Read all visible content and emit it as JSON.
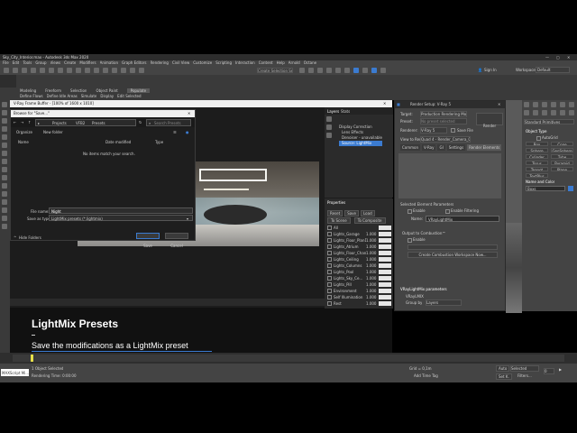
{
  "window": {
    "title": "Sky_City_Interior.max - Autodesk 3ds Max 2020"
  },
  "menu": [
    "File",
    "Edit",
    "Tools",
    "Group",
    "Views",
    "Create",
    "Modifiers",
    "Animation",
    "Graph Editors",
    "Rendering",
    "Civil View",
    "Customize",
    "Scripting",
    "Interaction",
    "Content",
    "Help",
    "Arnold",
    "Octane"
  ],
  "toolbar": {
    "selection_set": "Create Selection Set",
    "sign_in": "Sign In",
    "workspaces_label": "Workspaces:",
    "workspace_value": "Default"
  },
  "ribbon_tabs": [
    "Modeling",
    "Freeform",
    "Selection",
    "Object Paint",
    "Populate"
  ],
  "ribbon_sub": [
    "Define Flows",
    "Define Idle Areas",
    "Simulate",
    "Display",
    "Edit Selected"
  ],
  "vfb": {
    "title": "V-Ray Frame Buffer - [100% of 1600 x 1010]"
  },
  "browse": {
    "title": "Browse for \"Save...\"",
    "path": [
      "Projects",
      "VFB2",
      "Presets"
    ],
    "search_placeholder": "Search Presets",
    "organize": "Organize",
    "new_folder": "New folder",
    "col_name": "Name",
    "col_date": "Date modified",
    "col_type": "Type",
    "empty": "No items match your search.",
    "file_name_label": "File name:",
    "file_name_value": "Night",
    "save_type_label": "Save as type:",
    "save_type_value": "LightMix presets (*.lightmix)",
    "hide_folders": "Hide Folders",
    "save": "Save",
    "cancel": "Cancel"
  },
  "layers": {
    "tab1": "Layers",
    "tab2": "Stats",
    "items": [
      "Display Correction",
      "Lens Effects",
      "Denoiser - unavailable",
      "Source: LightMix"
    ]
  },
  "properties": {
    "title": "Properties",
    "reset": "Reset",
    "save": "Save",
    "load": "Load",
    "to_scene": "To Scene",
    "to_composite": "To Composite",
    "lights": [
      {
        "name": "All",
        "value": ""
      },
      {
        "name": "Lights_Garage",
        "value": "1.000"
      },
      {
        "name": "Lights_Floor_Plan1",
        "value": "1.000"
      },
      {
        "name": "Lights_Atrium",
        "value": "1.000"
      },
      {
        "name": "Lights_Floor_Chan2",
        "value": "1.000"
      },
      {
        "name": "Lights_Ceiling",
        "value": "1.000"
      },
      {
        "name": "Lights_Columns",
        "value": "1.000"
      },
      {
        "name": "Lights_Pool",
        "value": "1.000"
      },
      {
        "name": "Lights_Sky_Ce...",
        "value": "1.000"
      },
      {
        "name": "Lights_Pill",
        "value": "1.000"
      },
      {
        "name": "Environment",
        "value": "1.000"
      },
      {
        "name": "Self Illumination",
        "value": "1.000"
      },
      {
        "name": "Rest",
        "value": "1.000"
      }
    ]
  },
  "render_setup": {
    "title": "Render Setup: V-Ray 5",
    "target_label": "Target:",
    "target_value": "Production Rendering Mo...",
    "preset_label": "Preset:",
    "preset_value": "No preset selected",
    "renderer_label": "Renderer:",
    "renderer_value": "V-Ray 5",
    "save_file": "Save File",
    "view_label": "View to Render:",
    "view_value": "Quad 4 - Render_Camera_01",
    "render_btn": "Render",
    "tabs": [
      "Common",
      "V-Ray",
      "GI",
      "Settings",
      "Render Elements"
    ],
    "selected_params": "Selected Element Parameters",
    "enable": "Enable",
    "enable_filtering": "Enable Filtering",
    "name_label": "Name:",
    "name_value": "VRayLightMix",
    "output_comp": "Output to Combustion™",
    "enable2": "Enable",
    "create_comp": "Create Combustion Workspace Now...",
    "lightmix_params": "VRayLightMix parameters",
    "mode_label": "VRayLMIX",
    "group_by_label": "Group by",
    "group_by_value": "Layers"
  },
  "command_panel": {
    "dropdown": "Standard Primitives",
    "object_type": "Object Type",
    "autogrid": "AutoGrid",
    "buttons": [
      "Box",
      "Cone",
      "Sphere",
      "GeoSphere",
      "Cylinder",
      "Tube",
      "Torus",
      "Pyramid",
      "Teapot",
      "Plane",
      "TextPlus"
    ],
    "name_color": "Name and Color",
    "name_value": "Boxs"
  },
  "caption": {
    "title": "LightMix Presets",
    "subtitle": "Save the modifications as a LightMix preset"
  },
  "status": {
    "maxscript": "MAXScript Mi...",
    "selected": "1 Object Selected",
    "rendering_time": "Rendering Time: 0:00:00",
    "grid": "Grid = 0,1m",
    "add_time_tag": "Add Time Tag",
    "auto": "Auto",
    "set_k": "Set K.",
    "selected_dd": "Selected",
    "filters": "Filters...",
    "frame": "0"
  },
  "accent": "#3b7bd0"
}
